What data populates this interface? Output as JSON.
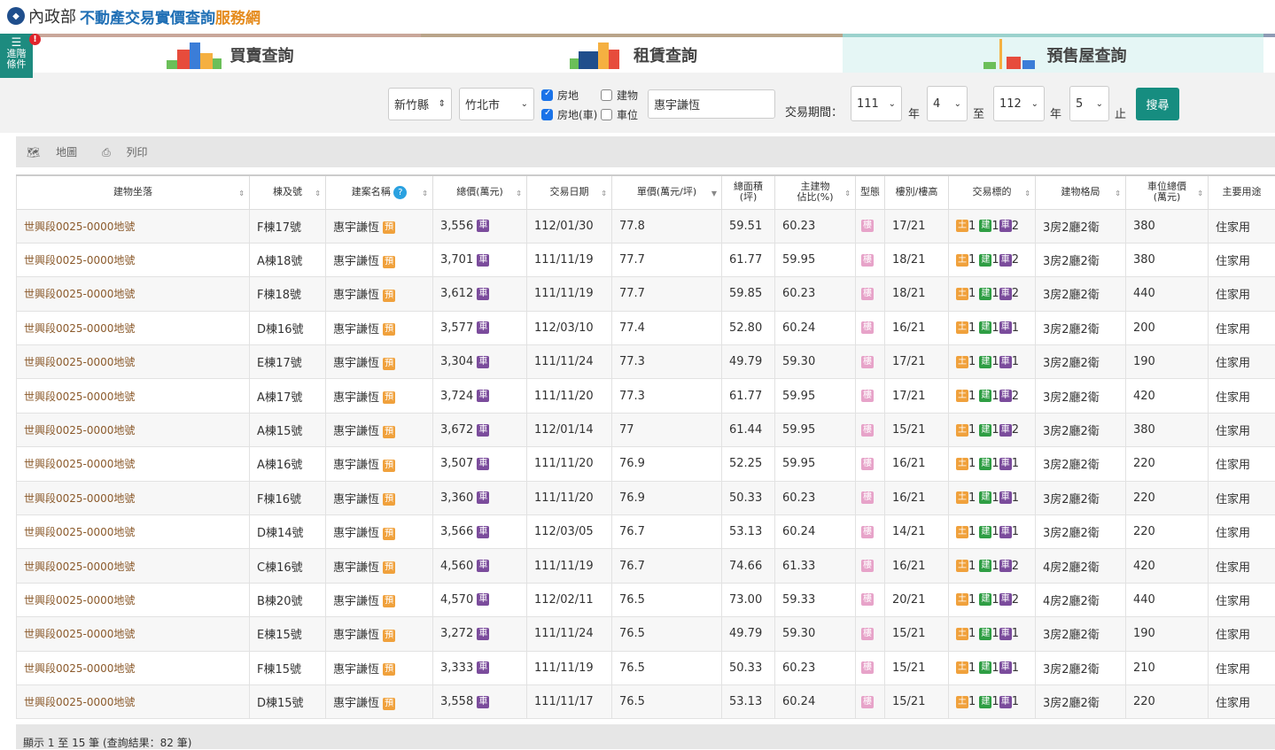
{
  "header": {
    "logo": "內政部",
    "title": "不動產交易實價查詢",
    "title_accent": "服務網"
  },
  "adv": {
    "label1": "進階",
    "label2": "條件",
    "badge": "!"
  },
  "tabs": [
    "買賣查詢",
    "租賃查詢",
    "預售屋查詢"
  ],
  "filter": {
    "county": "新竹縣",
    "town": "竹北市",
    "chk_house": "房地",
    "chk_building": "建物",
    "chk_house_car": "房地(車)",
    "chk_car": "車位",
    "keyword": "惠宇謙恆",
    "period_label": "交易期間：",
    "y1": "111",
    "m1": "4",
    "y2": "112",
    "m2": "5",
    "year": "年",
    "to": "至",
    "end": "止",
    "search": "搜尋"
  },
  "toolbar": {
    "map": "地圖",
    "print": "列印"
  },
  "columns": [
    "建物坐落",
    "棟及號",
    "建案名稱",
    "總價(萬元)",
    "交易日期",
    "單價(萬元/坪)",
    "總面積\n(坪)",
    "主建物\n佔比(%)",
    "型態",
    "樓別/樓高",
    "交易標的",
    "建物格局",
    "車位總價\n(萬元)",
    "主要用途"
  ],
  "rows": [
    [
      "世興段0025-0000地號",
      "F棟17號",
      "惠宇謙恆",
      "3,556",
      "112/01/30",
      "77.8",
      "59.51",
      "60.23",
      "17/21",
      "2",
      "3房2廳2衛",
      "380"
    ],
    [
      "世興段0025-0000地號",
      "A棟18號",
      "惠宇謙恆",
      "3,701",
      "111/11/19",
      "77.7",
      "61.77",
      "59.95",
      "18/21",
      "2",
      "3房2廳2衛",
      "380"
    ],
    [
      "世興段0025-0000地號",
      "F棟18號",
      "惠宇謙恆",
      "3,612",
      "111/11/19",
      "77.7",
      "59.85",
      "60.23",
      "18/21",
      "2",
      "3房2廳2衛",
      "440"
    ],
    [
      "世興段0025-0000地號",
      "D棟16號",
      "惠宇謙恆",
      "3,577",
      "112/03/10",
      "77.4",
      "52.80",
      "60.24",
      "16/21",
      "1",
      "3房2廳2衛",
      "200"
    ],
    [
      "世興段0025-0000地號",
      "E棟17號",
      "惠宇謙恆",
      "3,304",
      "111/11/24",
      "77.3",
      "49.79",
      "59.30",
      "17/21",
      "1",
      "3房2廳2衛",
      "190"
    ],
    [
      "世興段0025-0000地號",
      "A棟17號",
      "惠宇謙恆",
      "3,724",
      "111/11/20",
      "77.3",
      "61.77",
      "59.95",
      "17/21",
      "2",
      "3房2廳2衛",
      "420"
    ],
    [
      "世興段0025-0000地號",
      "A棟15號",
      "惠宇謙恆",
      "3,672",
      "112/01/14",
      "77",
      "61.44",
      "59.95",
      "15/21",
      "2",
      "3房2廳2衛",
      "380"
    ],
    [
      "世興段0025-0000地號",
      "A棟16號",
      "惠宇謙恆",
      "3,507",
      "111/11/20",
      "76.9",
      "52.25",
      "59.95",
      "16/21",
      "1",
      "3房2廳2衛",
      "220"
    ],
    [
      "世興段0025-0000地號",
      "F棟16號",
      "惠宇謙恆",
      "3,360",
      "111/11/20",
      "76.9",
      "50.33",
      "60.23",
      "16/21",
      "1",
      "3房2廳2衛",
      "220"
    ],
    [
      "世興段0025-0000地號",
      "D棟14號",
      "惠宇謙恆",
      "3,566",
      "112/03/05",
      "76.7",
      "53.13",
      "60.24",
      "14/21",
      "1",
      "3房2廳2衛",
      "220"
    ],
    [
      "世興段0025-0000地號",
      "C棟16號",
      "惠宇謙恆",
      "4,560",
      "111/11/19",
      "76.7",
      "74.66",
      "61.33",
      "16/21",
      "2",
      "4房2廳2衛",
      "420"
    ],
    [
      "世興段0025-0000地號",
      "B棟20號",
      "惠宇謙恆",
      "4,570",
      "112/02/11",
      "76.5",
      "73.00",
      "59.33",
      "20/21",
      "2",
      "4房2廳2衛",
      "440"
    ],
    [
      "世興段0025-0000地號",
      "E棟15號",
      "惠宇謙恆",
      "3,272",
      "111/11/24",
      "76.5",
      "49.79",
      "59.30",
      "15/21",
      "1",
      "3房2廳2衛",
      "190"
    ],
    [
      "世興段0025-0000地號",
      "F棟15號",
      "惠宇謙恆",
      "3,333",
      "111/11/19",
      "76.5",
      "50.33",
      "60.23",
      "15/21",
      "1",
      "3房2廳2衛",
      "210"
    ],
    [
      "世興段0025-0000地號",
      "D棟15號",
      "惠宇謙恆",
      "3,558",
      "111/11/17",
      "76.5",
      "53.13",
      "60.24",
      "15/21",
      "1",
      "3房2廳2衛",
      "220"
    ]
  ],
  "badges": {
    "car": "車",
    "pre": "預",
    "type": "樓",
    "land": "土",
    "build": "建",
    "one": "1"
  },
  "usage": "住家用",
  "footer": "顯示 1 至 15 筆 (查詢結果：82 筆)"
}
